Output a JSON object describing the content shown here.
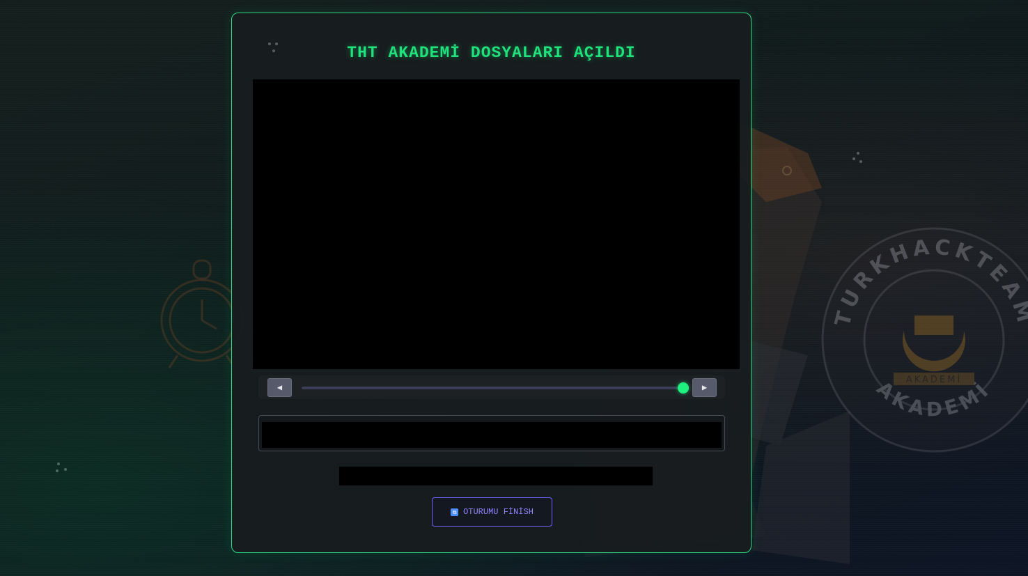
{
  "panel": {
    "title": "THT AKADEMİ DOSYALARI AÇILDI"
  },
  "player": {
    "prev_icon": "◀",
    "next_icon": "▶",
    "progress": 1.0,
    "caption_text": "",
    "status_text": ""
  },
  "finish_button": {
    "label": "OTURUMU FİNİSH",
    "icon": "session-icon"
  },
  "background": {
    "seal_text_top": "TURKHACKTEAM",
    "seal_text_bottom": "AKADEMİ",
    "seal_inner_text": "AKADEMİ"
  },
  "colors": {
    "accent": "#1fe27c",
    "button_border": "#6e63ff",
    "panel_border": "#2fdc86"
  }
}
